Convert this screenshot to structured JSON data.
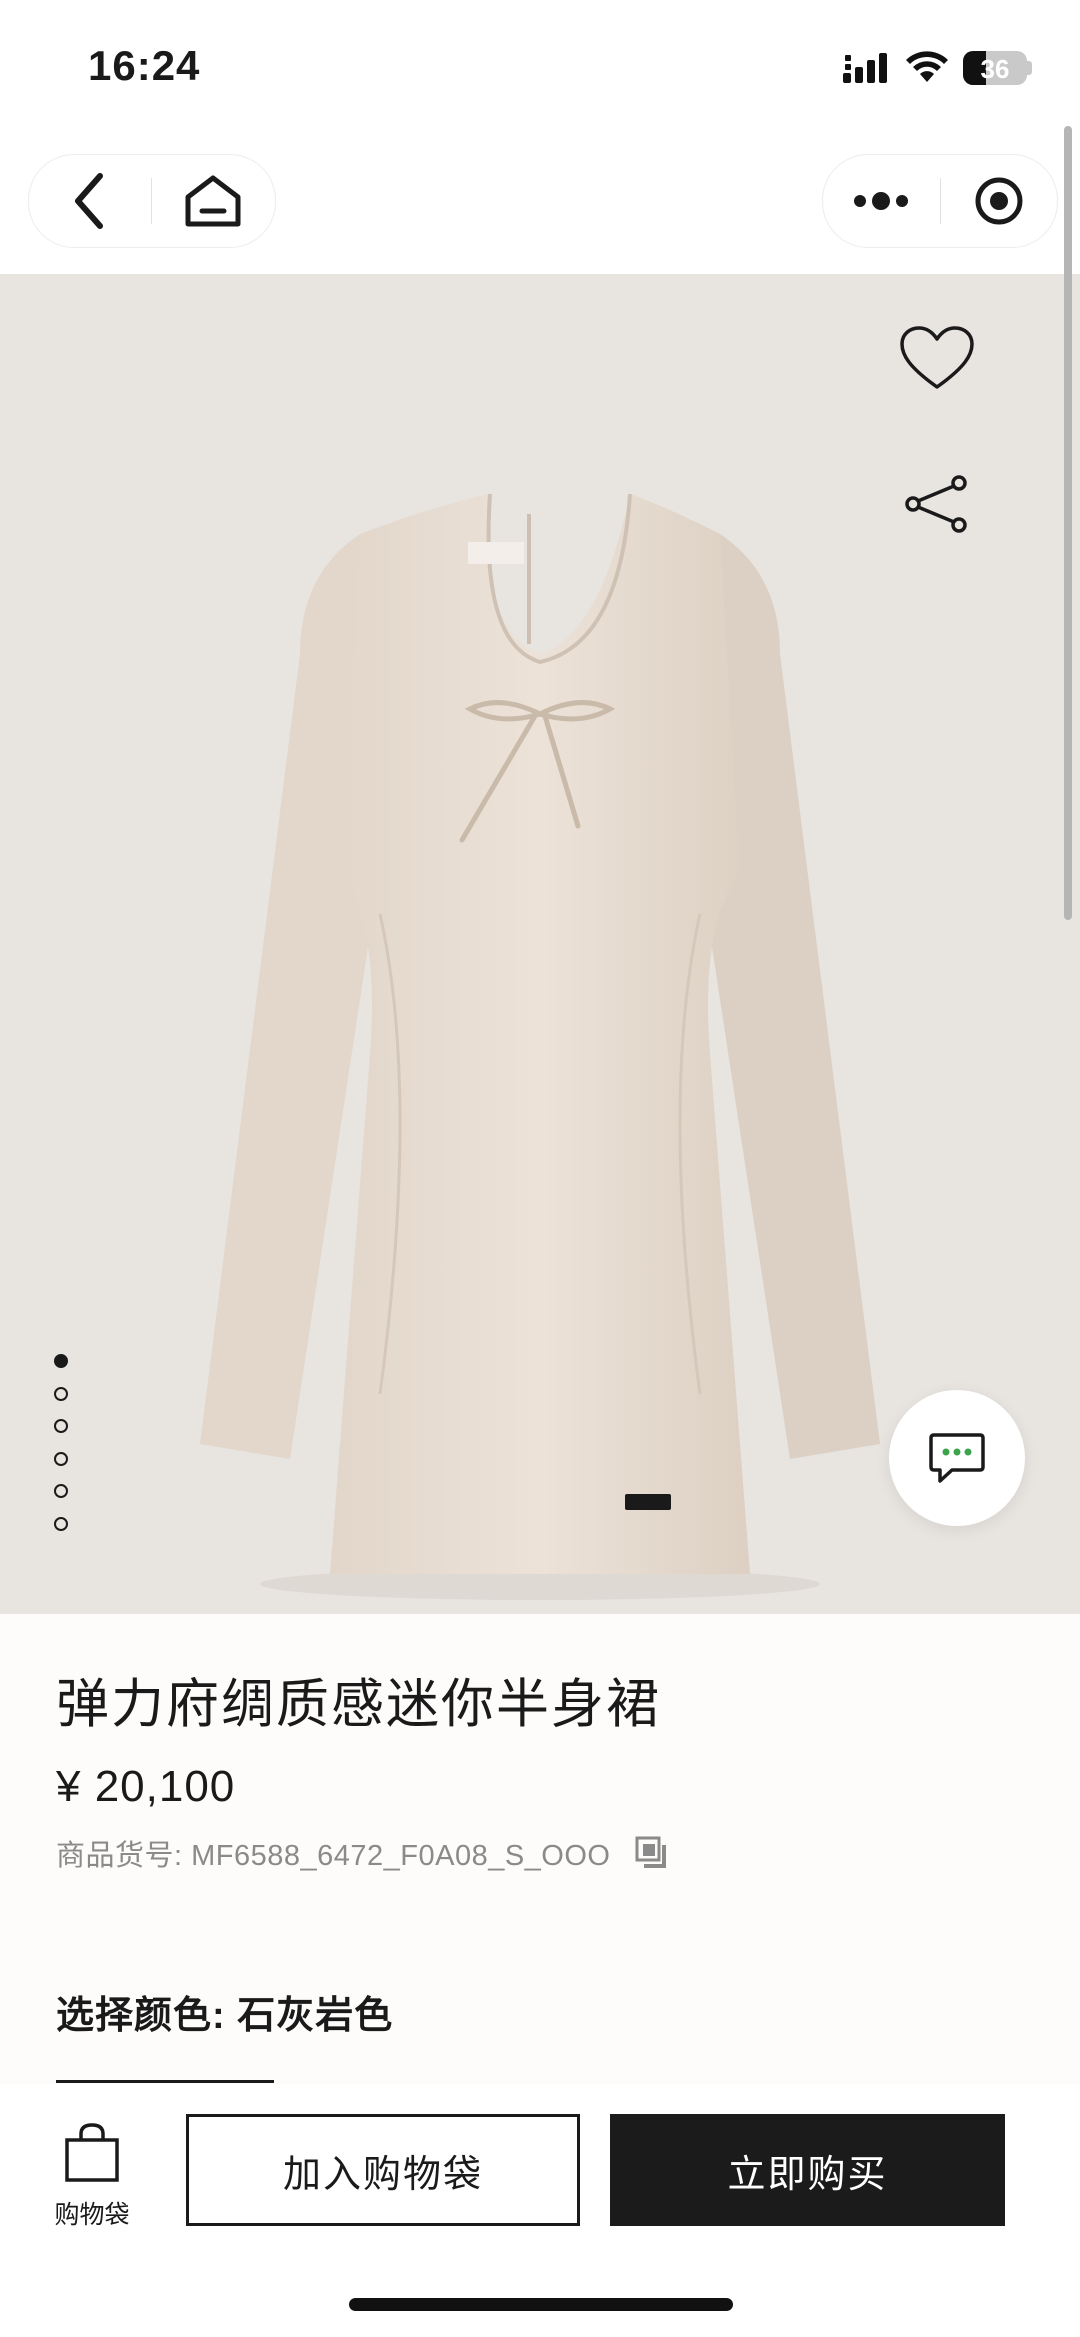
{
  "status_bar": {
    "time": "16:24",
    "battery_level": "36",
    "signal_icon": "cellular-signal-icon",
    "wifi_icon": "wifi-icon",
    "battery_icon": "battery-icon"
  },
  "nav": {
    "back_icon": "chevron-left-icon",
    "home_icon": "home-icon",
    "more_icon": "more-dots-icon",
    "close_icon": "target-circle-icon"
  },
  "gallery": {
    "image": "beige long-sleeve mini dress with front bow",
    "total_images": 6,
    "active_index": 0,
    "favorite_icon": "heart-icon",
    "share_icon": "share-icon",
    "chat_icon": "chat-bubble-icon"
  },
  "product": {
    "title": "弹力府绸质感迷你半身裙",
    "price": "¥ 20,100",
    "sku": "商品货号: MF6588_6472_F0A08_S_OOO",
    "copy_icon": "copy-icon",
    "color_label": "选择颜色: 石灰岩色"
  },
  "bottom_bar": {
    "bag_label": "购物袋",
    "bag_icon": "shopping-bag-icon",
    "add_to_bag": "加入购物袋",
    "buy_now": "立即购买"
  },
  "colors": {
    "hero_background": "#e8e4e0",
    "dress": "#e9ddd2",
    "primary_button": "#1b1b1b",
    "chat_accent": "#3aa34b"
  }
}
